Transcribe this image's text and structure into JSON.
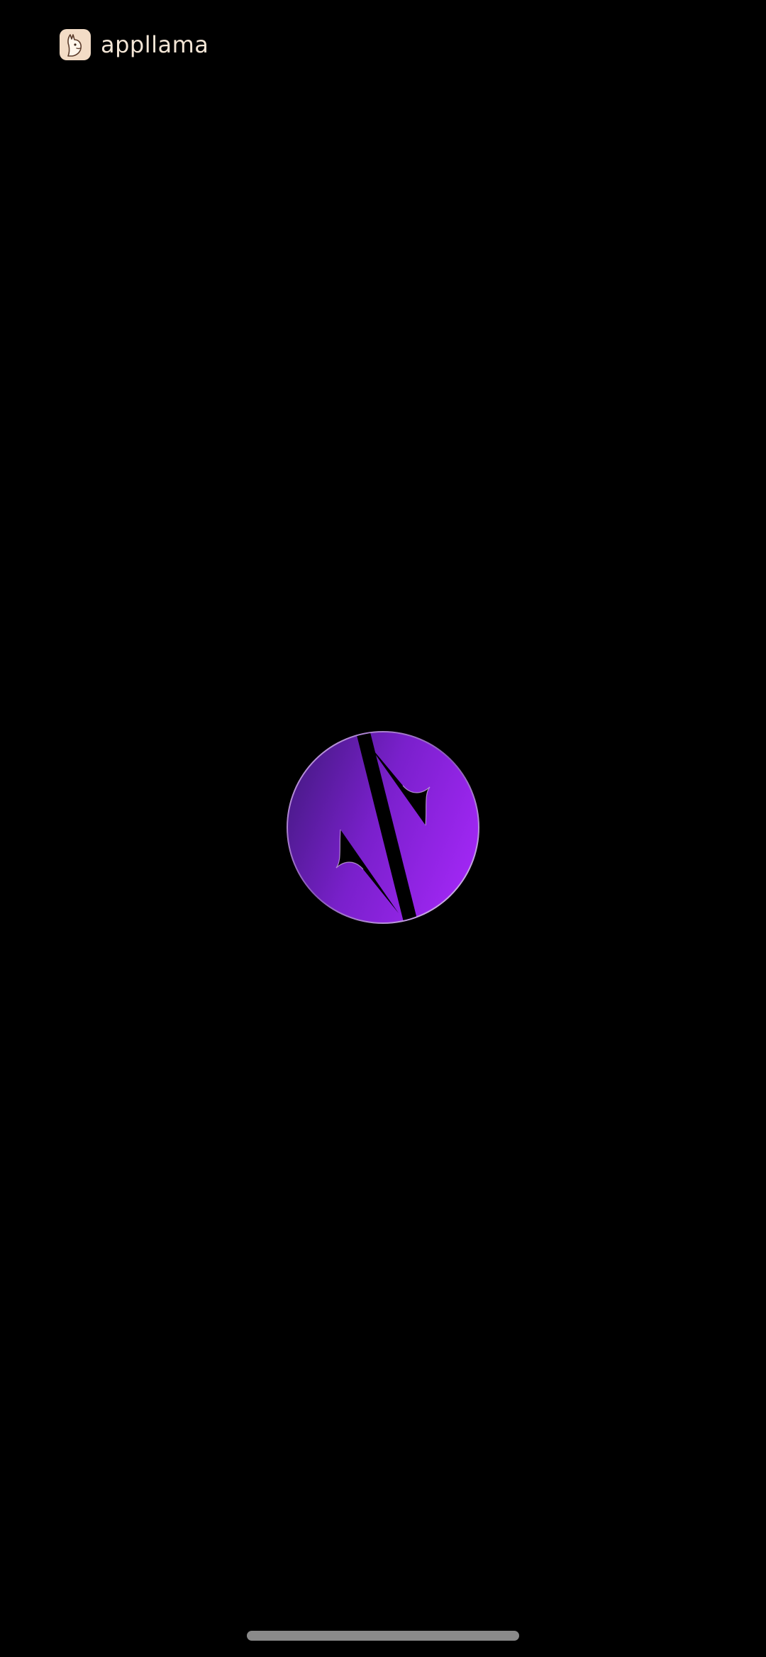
{
  "watermark": {
    "text": "appllama",
    "icon": "llama-icon",
    "color": "#f4e6d6"
  },
  "splash": {
    "logo": "app-logo-icon",
    "colors": {
      "gradient_start": "#4a1a8a",
      "gradient_end": "#a227f5",
      "background": "#000000"
    }
  },
  "system": {
    "home_indicator": "home-indicator"
  }
}
